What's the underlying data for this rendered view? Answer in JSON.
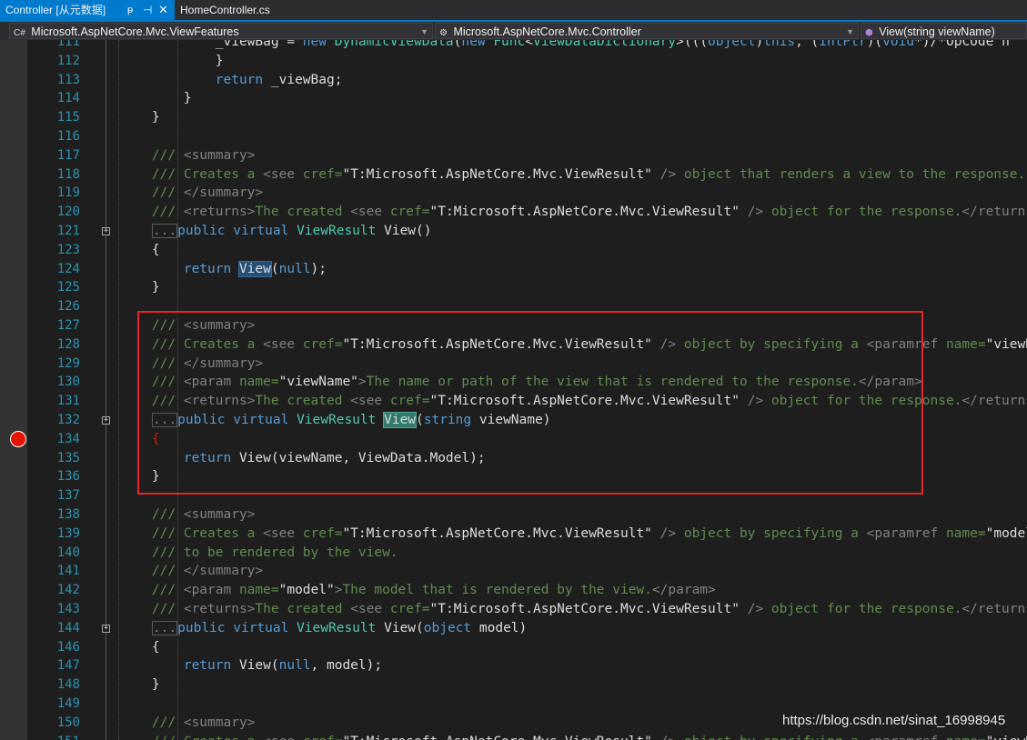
{
  "tabs": {
    "active": {
      "label": "Controller [从元数据]",
      "pin": "ᵽ",
      "keep": "⊣",
      "close": "✕"
    },
    "inactive": {
      "label": "HomeController.cs"
    }
  },
  "nav": {
    "project": {
      "label": "Microsoft.AspNetCore.Mvc.ViewFeatures",
      "icon": "csharp-project-icon"
    },
    "type": {
      "label": "Microsoft.AspNetCore.Mvc.Controller",
      "icon": "class-icon"
    },
    "member": {
      "label": "View(string viewName)",
      "icon": "method-icon"
    }
  },
  "breakpoint_line": "134",
  "lines": [
    {
      "num": "111",
      "fold": false
    },
    {
      "num": "112",
      "fold": false
    },
    {
      "num": "113",
      "fold": false
    },
    {
      "num": "114",
      "fold": false
    },
    {
      "num": "115",
      "fold": false
    },
    {
      "num": "116",
      "fold": false
    },
    {
      "num": "117",
      "fold": false
    },
    {
      "num": "118",
      "fold": false
    },
    {
      "num": "119",
      "fold": false
    },
    {
      "num": "120",
      "fold": false
    },
    {
      "num": "121",
      "fold": true
    },
    {
      "num": "123",
      "fold": false
    },
    {
      "num": "124",
      "fold": false
    },
    {
      "num": "125",
      "fold": false
    },
    {
      "num": "126",
      "fold": false
    },
    {
      "num": "127",
      "fold": false
    },
    {
      "num": "128",
      "fold": false
    },
    {
      "num": "129",
      "fold": false
    },
    {
      "num": "130",
      "fold": false
    },
    {
      "num": "131",
      "fold": false
    },
    {
      "num": "132",
      "fold": true
    },
    {
      "num": "134",
      "fold": false
    },
    {
      "num": "135",
      "fold": false
    },
    {
      "num": "136",
      "fold": false
    },
    {
      "num": "137",
      "fold": false
    },
    {
      "num": "138",
      "fold": false
    },
    {
      "num": "139",
      "fold": false
    },
    {
      "num": "140",
      "fold": false
    },
    {
      "num": "141",
      "fold": false
    },
    {
      "num": "142",
      "fold": false
    },
    {
      "num": "143",
      "fold": false
    },
    {
      "num": "144",
      "fold": true
    },
    {
      "num": "146",
      "fold": false
    },
    {
      "num": "147",
      "fold": false
    },
    {
      "num": "148",
      "fold": false
    },
    {
      "num": "149",
      "fold": false
    },
    {
      "num": "150",
      "fold": false
    },
    {
      "num": "151",
      "fold": false
    }
  ],
  "code": [
    [
      [
        "t",
        "            _viewBag = "
      ],
      [
        "k",
        "new "
      ],
      [
        "y",
        "DynamicViewData"
      ],
      [
        "t",
        "("
      ],
      [
        "k",
        "new "
      ],
      [
        "y",
        "Func"
      ],
      [
        "t",
        "<"
      ],
      [
        "y",
        "ViewDataDictionary"
      ],
      [
        "t",
        ">((("
      ],
      [
        "k",
        "object"
      ],
      [
        "t",
        ")"
      ],
      [
        "k",
        "this"
      ],
      [
        "t",
        ", ("
      ],
      [
        "k",
        "IntPtr"
      ],
      [
        "t",
        ")("
      ],
      [
        "k",
        "void"
      ],
      [
        "t",
        "*)/*OpCode n"
      ]
    ],
    [
      [
        "t",
        "            }"
      ]
    ],
    [
      [
        "t",
        "            "
      ],
      [
        "k",
        "return"
      ],
      [
        "t",
        " _viewBag;"
      ]
    ],
    [
      [
        "t",
        "        }"
      ]
    ],
    [
      [
        "t",
        "    }"
      ]
    ],
    [
      [
        "t",
        ""
      ]
    ],
    [
      [
        "g",
        "    /// "
      ],
      [
        "c",
        "<summary>"
      ]
    ],
    [
      [
        "g",
        "    /// Creates a "
      ],
      [
        "c",
        "<see "
      ],
      [
        "g",
        "cref="
      ],
      [
        "t",
        "\"T:Microsoft.AspNetCore.Mvc.ViewResult\""
      ],
      [
        "c",
        " /> "
      ],
      [
        "g",
        "object that renders a view to the response."
      ]
    ],
    [
      [
        "g",
        "    /// "
      ],
      [
        "c",
        "</summary>"
      ]
    ],
    [
      [
        "g",
        "    /// "
      ],
      [
        "c",
        "<returns>"
      ],
      [
        "g",
        "The created "
      ],
      [
        "c",
        "<see "
      ],
      [
        "g",
        "cref="
      ],
      [
        "t",
        "\"T:Microsoft.AspNetCore.Mvc.ViewResult\""
      ],
      [
        "c",
        " /> "
      ],
      [
        "g",
        "object for the response."
      ],
      [
        "c",
        "</returns>"
      ]
    ],
    [
      [
        "t",
        "    "
      ],
      [
        "e",
        "..."
      ],
      [
        "k",
        "public virtual "
      ],
      [
        "y",
        "ViewResult "
      ],
      [
        "t",
        "View()"
      ]
    ],
    [
      [
        "t",
        "    {"
      ]
    ],
    [
      [
        "t",
        "        "
      ],
      [
        "k",
        "return "
      ],
      [
        "r",
        "View"
      ],
      [
        "t",
        "("
      ],
      [
        "k",
        "null"
      ],
      [
        "t",
        ");"
      ]
    ],
    [
      [
        "t",
        "    }"
      ]
    ],
    [
      [
        "t",
        ""
      ]
    ],
    [
      [
        "g",
        "    /// "
      ],
      [
        "c",
        "<summary>"
      ]
    ],
    [
      [
        "g",
        "    /// Creates a "
      ],
      [
        "c",
        "<see "
      ],
      [
        "g",
        "cref="
      ],
      [
        "t",
        "\"T:Microsoft.AspNetCore.Mvc.ViewResult\""
      ],
      [
        "c",
        " /> "
      ],
      [
        "g",
        "object by specifying a "
      ],
      [
        "c",
        "<paramref "
      ],
      [
        "g",
        "name="
      ],
      [
        "t",
        "\"viewN"
      ]
    ],
    [
      [
        "g",
        "    /// "
      ],
      [
        "c",
        "</summary>"
      ]
    ],
    [
      [
        "g",
        "    /// "
      ],
      [
        "c",
        "<param "
      ],
      [
        "g",
        "name="
      ],
      [
        "t",
        "\"viewName\""
      ],
      [
        "c",
        ">"
      ],
      [
        "g",
        "The name or path of the view that is rendered to the response."
      ],
      [
        "c",
        "</param>"
      ]
    ],
    [
      [
        "g",
        "    /// "
      ],
      [
        "c",
        "<returns>"
      ],
      [
        "g",
        "The created "
      ],
      [
        "c",
        "<see "
      ],
      [
        "g",
        "cref="
      ],
      [
        "t",
        "\"T:Microsoft.AspNetCore.Mvc.ViewResult\""
      ],
      [
        "c",
        " /> "
      ],
      [
        "g",
        "object for the response."
      ],
      [
        "c",
        "</returns>"
      ]
    ],
    [
      [
        "t",
        "    "
      ],
      [
        "e",
        "..."
      ],
      [
        "k",
        "public virtual "
      ],
      [
        "y",
        "ViewResult "
      ],
      [
        "s",
        "View"
      ],
      [
        "t",
        "("
      ],
      [
        "k",
        "string "
      ],
      [
        "t",
        "viewName)"
      ]
    ],
    [
      [
        "t",
        "    "
      ],
      [
        "b",
        "{"
      ]
    ],
    [
      [
        "t",
        "        "
      ],
      [
        "k",
        "return "
      ],
      [
        "t",
        "View(viewName, ViewData.Model);"
      ]
    ],
    [
      [
        "t",
        "    }"
      ]
    ],
    [
      [
        "t",
        ""
      ]
    ],
    [
      [
        "g",
        "    /// "
      ],
      [
        "c",
        "<summary>"
      ]
    ],
    [
      [
        "g",
        "    /// Creates a "
      ],
      [
        "c",
        "<see "
      ],
      [
        "g",
        "cref="
      ],
      [
        "t",
        "\"T:Microsoft.AspNetCore.Mvc.ViewResult\""
      ],
      [
        "c",
        " /> "
      ],
      [
        "g",
        "object by specifying a "
      ],
      [
        "c",
        "<paramref "
      ],
      [
        "g",
        "name="
      ],
      [
        "t",
        "\"model"
      ]
    ],
    [
      [
        "g",
        "    /// to be rendered by the view."
      ]
    ],
    [
      [
        "g",
        "    /// "
      ],
      [
        "c",
        "</summary>"
      ]
    ],
    [
      [
        "g",
        "    /// "
      ],
      [
        "c",
        "<param "
      ],
      [
        "g",
        "name="
      ],
      [
        "t",
        "\"model\""
      ],
      [
        "c",
        ">"
      ],
      [
        "g",
        "The model that is rendered by the view."
      ],
      [
        "c",
        "</param>"
      ]
    ],
    [
      [
        "g",
        "    /// "
      ],
      [
        "c",
        "<returns>"
      ],
      [
        "g",
        "The created "
      ],
      [
        "c",
        "<see "
      ],
      [
        "g",
        "cref="
      ],
      [
        "t",
        "\"T:Microsoft.AspNetCore.Mvc.ViewResult\""
      ],
      [
        "c",
        " /> "
      ],
      [
        "g",
        "object for the response."
      ],
      [
        "c",
        "</returns>"
      ]
    ],
    [
      [
        "t",
        "    "
      ],
      [
        "e",
        "..."
      ],
      [
        "k",
        "public virtual "
      ],
      [
        "y",
        "ViewResult "
      ],
      [
        "t",
        "View("
      ],
      [
        "k",
        "object "
      ],
      [
        "t",
        "model)"
      ]
    ],
    [
      [
        "t",
        "    {"
      ]
    ],
    [
      [
        "t",
        "        "
      ],
      [
        "k",
        "return "
      ],
      [
        "t",
        "View("
      ],
      [
        "k",
        "null"
      ],
      [
        "t",
        ", model);"
      ]
    ],
    [
      [
        "t",
        "    }"
      ]
    ],
    [
      [
        "t",
        ""
      ]
    ],
    [
      [
        "g",
        "    /// "
      ],
      [
        "c",
        "<summary>"
      ]
    ],
    [
      [
        "g",
        "    /// Creates a "
      ],
      [
        "c",
        "<see "
      ],
      [
        "g",
        "cref="
      ],
      [
        "t",
        "\"T:Microsoft.AspNetCore.Mvc.ViewResult\""
      ],
      [
        "c",
        " /> "
      ],
      [
        "g",
        "object by specifying a "
      ],
      [
        "c",
        "<paramref "
      ],
      [
        "g",
        "name="
      ],
      [
        "t",
        "\"viewN"
      ]
    ]
  ],
  "watermark": "https://blog.csdn.net/sinat_16998945"
}
